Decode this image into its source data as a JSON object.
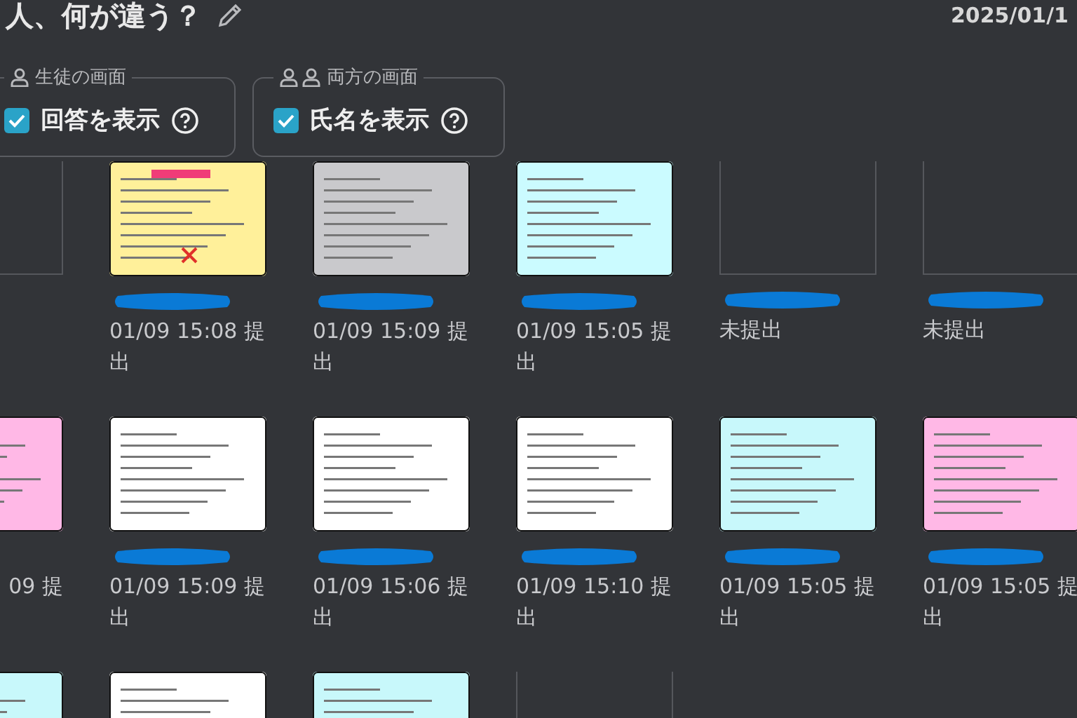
{
  "header": {
    "title": "人、何が違う？",
    "date": "2025/01/1"
  },
  "view_options": [
    {
      "legend": "生徒の画面",
      "label": "回答を表示",
      "checked": true
    },
    {
      "legend": "両方の画面",
      "label": "氏名を表示",
      "checked": true
    }
  ],
  "grid": {
    "rows": [
      [
        {
          "kind": "missing"
        },
        {
          "kind": "submitted",
          "color": "#fff09a",
          "name_hidden": true,
          "corrected": true,
          "submitted_text": "01/09 15:08 提出"
        },
        {
          "kind": "submitted",
          "color": "#c9c9cc",
          "name_hidden": true,
          "submitted_text": "01/09 15:09 提出"
        },
        {
          "kind": "submitted",
          "color": "#cbfbff",
          "name_hidden": true,
          "submitted_text": "01/09 15:05 提出"
        },
        {
          "kind": "missing",
          "name_hidden": true,
          "submitted_text": "未提出"
        },
        {
          "kind": "missing",
          "name_hidden": true,
          "submitted_text": "未提出"
        }
      ],
      [
        {
          "kind": "submitted",
          "color": "#ffb8e6",
          "submitted_text": "09 提"
        },
        {
          "kind": "submitted",
          "color": "#ffffff",
          "name_hidden": true,
          "submitted_text": "01/09 15:09 提出"
        },
        {
          "kind": "submitted",
          "color": "#ffffff",
          "name_hidden": true,
          "submitted_text": "01/09 15:06 提出"
        },
        {
          "kind": "submitted",
          "color": "#ffffff",
          "name_hidden": true,
          "submitted_text": "01/09 15:10 提出"
        },
        {
          "kind": "submitted",
          "color": "#c8f8fb",
          "name_hidden": true,
          "submitted_text": "01/09 15:05 提出"
        },
        {
          "kind": "submitted",
          "color": "#ffb8e6",
          "name_hidden": true,
          "submitted_text": "01/09 15:05 提出"
        }
      ],
      [
        {
          "kind": "submitted",
          "color": "#c8f8fb"
        },
        {
          "kind": "submitted",
          "color": "#ffffff"
        },
        {
          "kind": "submitted",
          "color": "#c8f8fb"
        },
        {
          "kind": "missing"
        }
      ]
    ]
  }
}
